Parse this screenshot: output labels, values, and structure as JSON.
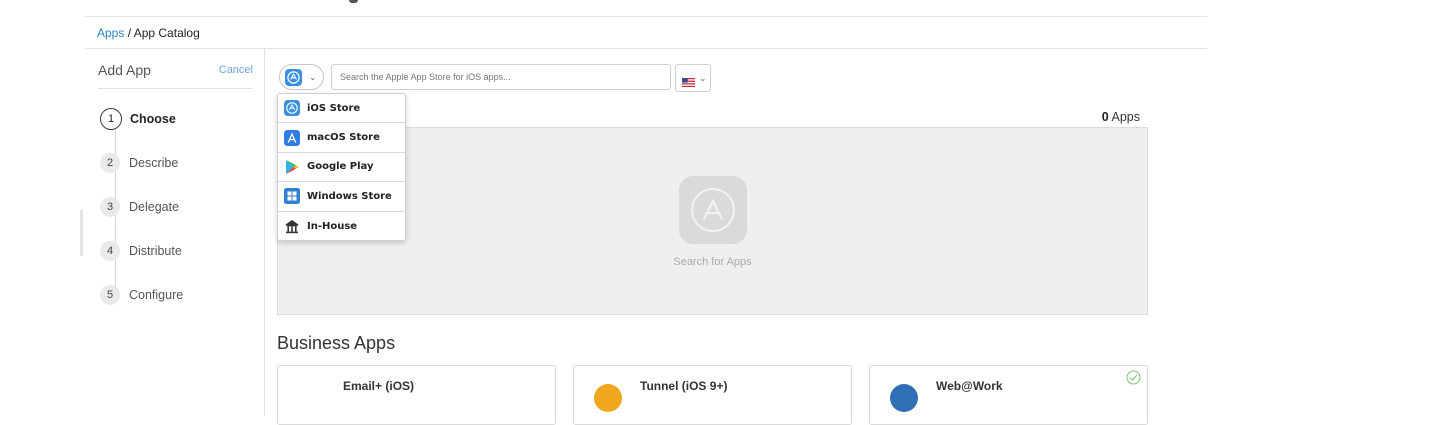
{
  "breadcrumb": {
    "root": "Apps",
    "separator": " / ",
    "current": "App Catalog"
  },
  "sidebar": {
    "title": "Add App",
    "cancel_label": "Cancel",
    "steps": [
      {
        "number": "1",
        "label": "Choose",
        "active": true
      },
      {
        "number": "2",
        "label": "Describe"
      },
      {
        "number": "3",
        "label": "Delegate"
      },
      {
        "number": "4",
        "label": "Distribute"
      },
      {
        "number": "5",
        "label": "Configure"
      }
    ]
  },
  "toolbar": {
    "store_icon": "ios-store-icon",
    "search_placeholder": "Search the Apple App Store for iOS apps...",
    "search_value": "",
    "region_icon": "us-flag-icon"
  },
  "store_menu": {
    "items": [
      {
        "label": "iOS Store",
        "icon": "ios-store-icon"
      },
      {
        "label": "macOS Store",
        "icon": "macos-store-icon"
      },
      {
        "label": "Google Play",
        "icon": "google-play-icon"
      },
      {
        "label": "Windows Store",
        "icon": "windows-store-icon"
      },
      {
        "label": "In-House",
        "icon": "in-house-icon"
      }
    ]
  },
  "results": {
    "count": "0",
    "count_suffix": " Apps",
    "empty_text": "Search for Apps"
  },
  "business_apps": {
    "title": "Business Apps",
    "cards": [
      {
        "name": "Email+ (iOS)"
      },
      {
        "name": "Tunnel (iOS 9+)"
      },
      {
        "name": "Web@Work",
        "installed": true
      }
    ]
  },
  "colors": {
    "accent": "#2a85c8",
    "ios_blue": "#3d8fe0",
    "panel_bg": "#efefef"
  }
}
